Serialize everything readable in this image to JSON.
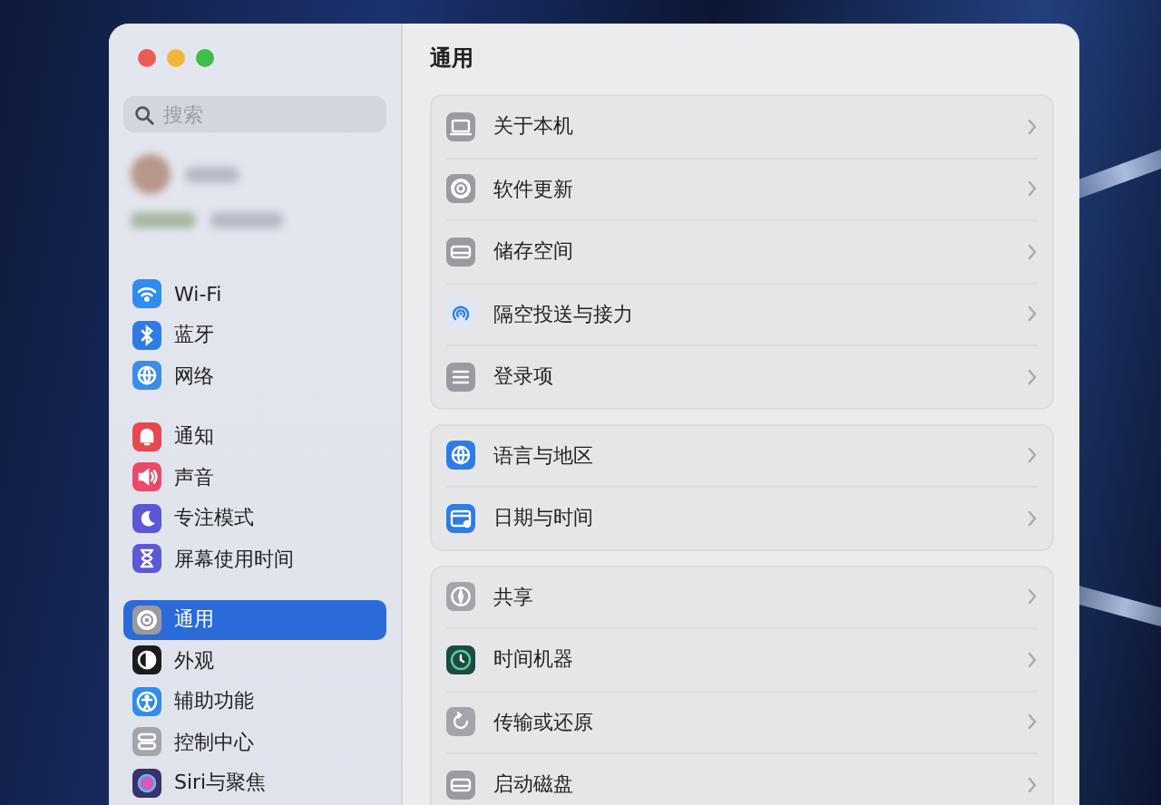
{
  "window": {
    "title": "通用"
  },
  "search": {
    "placeholder": "搜索"
  },
  "sidebar": {
    "groups": [
      {
        "items": [
          {
            "label": "Wi-Fi",
            "kind": "wifi",
            "selected": false
          },
          {
            "label": "蓝牙",
            "kind": "bluetooth",
            "selected": false
          },
          {
            "label": "网络",
            "kind": "network",
            "selected": false
          }
        ]
      },
      {
        "items": [
          {
            "label": "通知",
            "kind": "bell",
            "selected": false
          },
          {
            "label": "声音",
            "kind": "sound",
            "selected": false
          },
          {
            "label": "专注模式",
            "kind": "moon",
            "selected": false
          },
          {
            "label": "屏幕使用时间",
            "kind": "hourglass",
            "selected": false
          }
        ]
      },
      {
        "items": [
          {
            "label": "通用",
            "kind": "gear",
            "selected": true
          },
          {
            "label": "外观",
            "kind": "appearance",
            "selected": false
          },
          {
            "label": "辅助功能",
            "kind": "accessibility",
            "selected": false
          },
          {
            "label": "控制中心",
            "kind": "toggles",
            "selected": false
          },
          {
            "label": "Siri与聚焦",
            "kind": "siri",
            "selected": false
          }
        ]
      }
    ]
  },
  "content": {
    "groups": [
      {
        "rows": [
          {
            "label": "关于本机",
            "kind": "laptop"
          },
          {
            "label": "软件更新",
            "kind": "gear"
          },
          {
            "label": "储存空间",
            "kind": "drive"
          },
          {
            "label": "隔空投送与接力",
            "kind": "airdrop"
          },
          {
            "label": "登录项",
            "kind": "list"
          }
        ]
      },
      {
        "rows": [
          {
            "label": "语言与地区",
            "kind": "globe"
          },
          {
            "label": "日期与时间",
            "kind": "calendar"
          }
        ]
      },
      {
        "rows": [
          {
            "label": "共享",
            "kind": "share"
          },
          {
            "label": "时间机器",
            "kind": "clock"
          },
          {
            "label": "传输或还原",
            "kind": "restore"
          },
          {
            "label": "启动磁盘",
            "kind": "drive"
          }
        ]
      }
    ]
  }
}
